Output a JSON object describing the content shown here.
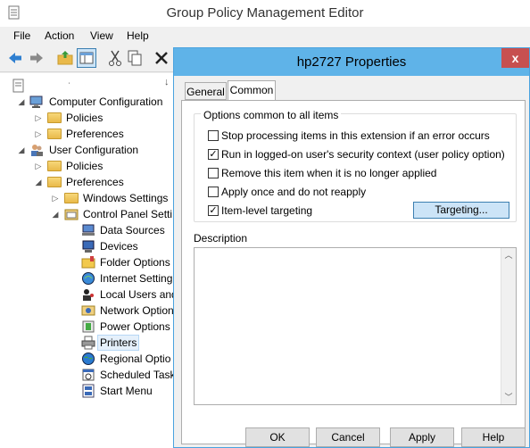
{
  "window": {
    "title": "Group Policy Management Editor"
  },
  "menu": [
    "File",
    "Action",
    "View",
    "Help"
  ],
  "toolbar": {
    "icons": [
      "back-arrow-icon",
      "forward-arrow-icon",
      "up-folder-icon",
      "show-hide-tree-icon",
      "cut-icon",
      "copy-icon",
      "delete-icon"
    ]
  },
  "tree": {
    "items": [
      {
        "label": "Computer Configuration"
      },
      {
        "label": "Policies"
      },
      {
        "label": "Preferences"
      },
      {
        "label": "User Configuration"
      },
      {
        "label": "Policies"
      },
      {
        "label": "Preferences"
      },
      {
        "label": "Windows Settings"
      },
      {
        "label": "Control Panel Setti"
      },
      {
        "label": "Data Sources"
      },
      {
        "label": "Devices"
      },
      {
        "label": "Folder Options"
      },
      {
        "label": "Internet Setting"
      },
      {
        "label": "Local Users and"
      },
      {
        "label": "Network Option"
      },
      {
        "label": "Power Options"
      },
      {
        "label": "Printers"
      },
      {
        "label": "Regional Optio"
      },
      {
        "label": "Scheduled Task"
      },
      {
        "label": "Start Menu"
      }
    ]
  },
  "dialog": {
    "title": "hp2727 Properties",
    "close": "x",
    "tabs": [
      "General",
      "Common"
    ],
    "group_title": "Options common to all items",
    "options": [
      {
        "label": "Stop processing items in this extension if an error occurs",
        "checked": false
      },
      {
        "label": "Run in logged-on user's security context (user policy option)",
        "checked": true
      },
      {
        "label": "Remove this item when it is no longer applied",
        "checked": false
      },
      {
        "label": "Apply once and do not reapply",
        "checked": false
      },
      {
        "label": "Item-level targeting",
        "checked": true
      }
    ],
    "targeting_button": "Targeting...",
    "description_label": "Description",
    "description_value": "",
    "buttons": {
      "ok": "OK",
      "cancel": "Cancel",
      "apply": "Apply",
      "help": "Help"
    }
  }
}
